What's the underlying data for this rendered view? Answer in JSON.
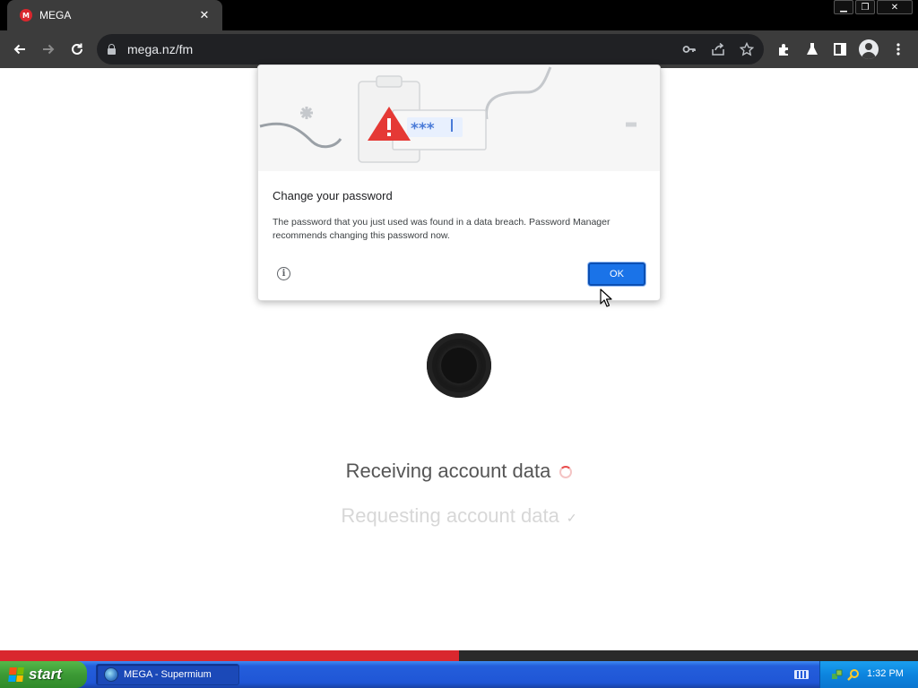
{
  "browser": {
    "tab_title": "MEGA",
    "tab_favicon_letter": "M",
    "url": "mega.nz/fm",
    "accent_color": "#d9272e"
  },
  "window_controls": {
    "minimize": "minimize-icon",
    "restore": "restore-icon",
    "close": "close-icon"
  },
  "toolbar_icons": [
    "back-arrow-icon",
    "forward-arrow-icon",
    "reload-icon",
    "key-icon",
    "share-icon",
    "star-icon",
    "extensions-icon",
    "flask-icon",
    "side-panel-icon",
    "profile-icon",
    "more-vert-icon"
  ],
  "dialog": {
    "title": "Change your password",
    "body": "The password that you just used was found in a data breach. Password Manager recommends changing this password now.",
    "ok_label": "OK",
    "illustration_text": "***",
    "ok_color": "#1a73e8"
  },
  "page": {
    "status_main": "Receiving account data",
    "status_sub": "Requesting account data",
    "progress_fraction": 0.5
  },
  "taskbar": {
    "start_label": "start",
    "task_label": "MEGA - Supermium",
    "clock": "1:32 PM"
  }
}
